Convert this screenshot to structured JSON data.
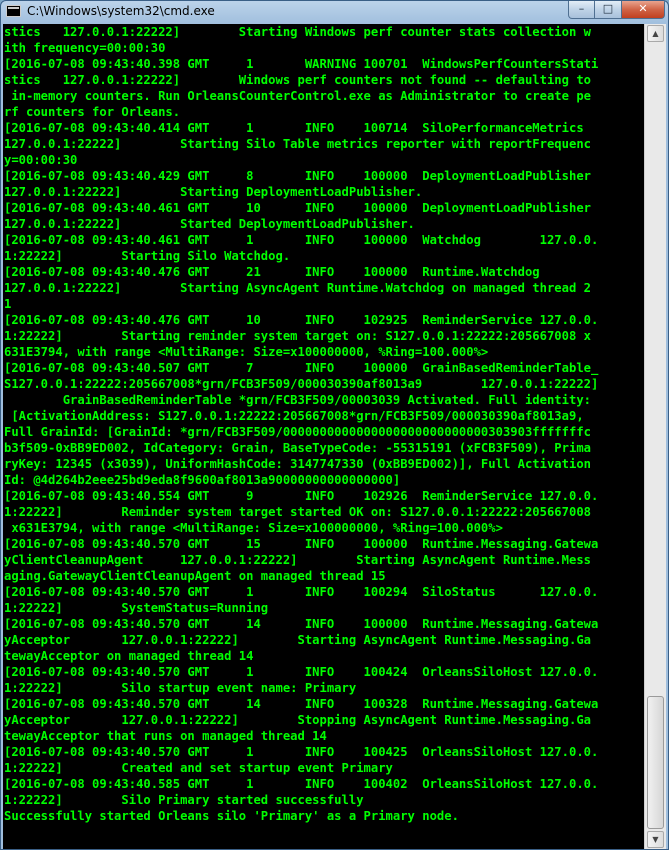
{
  "window": {
    "title": "C:\\Windows\\system32\\cmd.exe",
    "icon": "console-icon",
    "buttons": {
      "minimize": "–",
      "maximize": "□",
      "close": "✕"
    }
  },
  "scrollbar": {
    "up_arrow": "▲",
    "down_arrow": "▼",
    "position": 0.97
  },
  "console": {
    "text_color": "#00ff00",
    "background_color": "#000000",
    "lines": [
      "stics   127.0.0.1:22222]        Starting Windows perf counter stats collection w",
      "ith frequency=00:00:30",
      "[2016-07-08 09:43:40.398 GMT     1       WARNING 100701  WindowsPerfCountersStati",
      "stics   127.0.0.1:22222]        Windows perf counters not found -- defaulting to",
      " in-memory counters. Run OrleansCounterControl.exe as Administrator to create pe",
      "rf counters for Orleans.",
      "[2016-07-08 09:43:40.414 GMT     1       INFO    100714  SiloPerformanceMetrics",
      "127.0.0.1:22222]        Starting Silo Table metrics reporter with reportFrequenc",
      "y=00:00:30",
      "[2016-07-08 09:43:40.429 GMT     8       INFO    100000  DeploymentLoadPublisher",
      "127.0.0.1:22222]        Starting DeploymentLoadPublisher.",
      "[2016-07-08 09:43:40.461 GMT     10      INFO    100000  DeploymentLoadPublisher",
      "127.0.0.1:22222]        Started DeploymentLoadPublisher.",
      "[2016-07-08 09:43:40.461 GMT     1       INFO    100000  Watchdog        127.0.0.",
      "1:22222]        Starting Silo Watchdog.",
      "[2016-07-08 09:43:40.476 GMT     21      INFO    100000  Runtime.Watchdog",
      "127.0.0.1:22222]        Starting AsyncAgent Runtime.Watchdog on managed thread 2",
      "1",
      "[2016-07-08 09:43:40.476 GMT     10      INFO    102925  ReminderService 127.0.0.",
      "1:22222]        Starting reminder system target on: S127.0.0.1:22222:205667008 x",
      "631E3794, with range <MultiRange: Size=x100000000, %Ring=100.000%>",
      "[2016-07-08 09:43:40.507 GMT     7       INFO    100000  GrainBasedReminderTable_",
      "S127.0.0.1:22222:205667008*grn/FCB3F509/000030390af8013a9        127.0.0.1:22222]",
      "        GrainBasedReminderTable *grn/FCB3F509/00003039 Activated. Full identity:",
      " [ActivationAddress: S127.0.0.1:22222:205667008*grn/FCB3F509/000030390af8013a9,",
      "Full GrainId: [GrainId: *grn/FCB3F509/0000000000000000000000000000303903fffffffc",
      "b3f509-0xBB9ED002, IdCategory: Grain, BaseTypeCode: -55315191 (xFCB3F509), Prima",
      "ryKey: 12345 (x3039), UniformHashCode: 3147747330 (0xBB9ED002)], Full Activation",
      "Id: @4d264b2eee25bd9eda8f9600af8013a90000000000000000]",
      "[2016-07-08 09:43:40.554 GMT     9       INFO    102926  ReminderService 127.0.0.",
      "1:22222]        Reminder system target started OK on: S127.0.0.1:22222:205667008",
      " x631E3794, with range <MultiRange: Size=x100000000, %Ring=100.000%>",
      "[2016-07-08 09:43:40.570 GMT     15      INFO    100000  Runtime.Messaging.Gatewa",
      "yClientCleanupAgent     127.0.0.1:22222]        Starting AsyncAgent Runtime.Mess",
      "aging.GatewayClientCleanupAgent on managed thread 15",
      "[2016-07-08 09:43:40.570 GMT     1       INFO    100294  SiloStatus      127.0.0.",
      "1:22222]        SystemStatus=Running",
      "[2016-07-08 09:43:40.570 GMT     14      INFO    100000  Runtime.Messaging.Gatewa",
      "yAcceptor       127.0.0.1:22222]        Starting AsyncAgent Runtime.Messaging.Ga",
      "tewayAcceptor on managed thread 14",
      "[2016-07-08 09:43:40.570 GMT     1       INFO    100424  OrleansSiloHost 127.0.0.",
      "1:22222]        Silo startup event name: Primary",
      "[2016-07-08 09:43:40.570 GMT     14      INFO    100328  Runtime.Messaging.Gatewa",
      "yAcceptor       127.0.0.1:22222]        Stopping AsyncAgent Runtime.Messaging.Ga",
      "tewayAcceptor that runs on managed thread 14",
      "[2016-07-08 09:43:40.570 GMT     1       INFO    100425  OrleansSiloHost 127.0.0.",
      "1:22222]        Created and set startup event Primary",
      "[2016-07-08 09:43:40.585 GMT     1       INFO    100402  OrleansSiloHost 127.0.0.",
      "1:22222]        Silo Primary started successfully",
      "Successfully started Orleans silo 'Primary' as a Primary node."
    ]
  }
}
